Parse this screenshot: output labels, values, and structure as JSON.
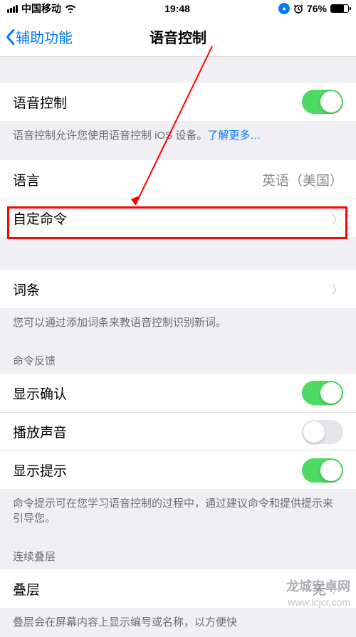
{
  "status": {
    "carrier": "中国移动",
    "time": "19:48",
    "battery": "76%"
  },
  "nav": {
    "back": "辅助功能",
    "title": "语音控制"
  },
  "voice_control": {
    "label": "语音控制",
    "desc_prefix": "语音控制允许您使用语音控制 iOS 设备。",
    "desc_link": "了解更多…"
  },
  "language": {
    "label": "语言",
    "value": "英语（美国）"
  },
  "custom_cmd": {
    "label": "自定命令"
  },
  "vocab": {
    "label": "词条",
    "desc": "您可以通过添加词条来教语音控制识别新词。"
  },
  "feedback": {
    "header": "命令反馈",
    "show_confirm": "显示确认",
    "play_sound": "播放声音",
    "show_hint": "显示提示",
    "desc": "命令提示可在您学习语音控制的过程中，通过建议命令和提供提示来引导您。"
  },
  "overlay": {
    "header": "连续叠层",
    "label": "叠层",
    "value": "无",
    "desc": "叠层会在屏幕内容上显示编号或名称，以方便快"
  },
  "watermark": {
    "name": "龙城安卓网",
    "url": "www.lcjcr.com"
  }
}
